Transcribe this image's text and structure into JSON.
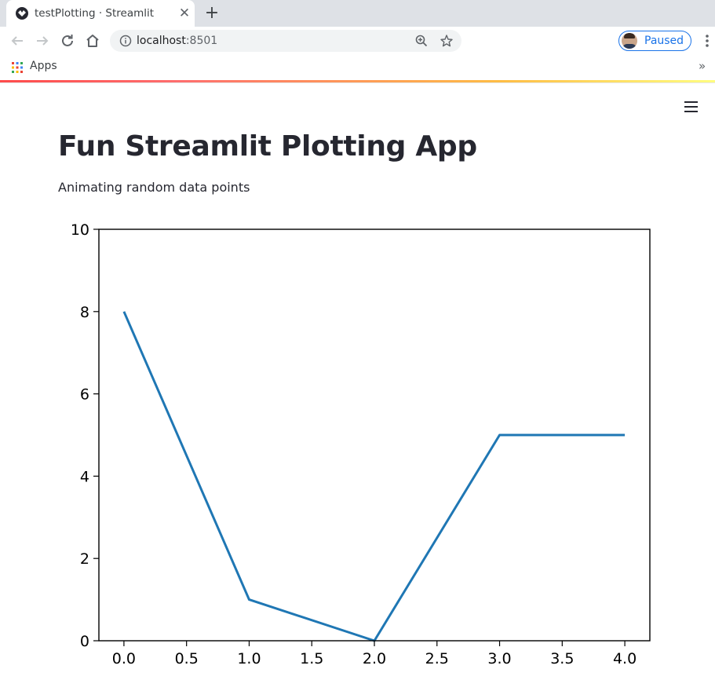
{
  "browser": {
    "tab": {
      "title": "testPlotting · Streamlit",
      "close_glyph": "✕"
    },
    "newtab_glyph": "+",
    "address": {
      "host": "localhost",
      "port": ":8501"
    },
    "profile": {
      "label": "Paused"
    },
    "bookmarks": {
      "apps_label": "Apps",
      "more_glyph": "»"
    },
    "accent_gradient": [
      "#ff4b4b",
      "#ffbd45",
      "#fffd80"
    ]
  },
  "app": {
    "menu_icon": "hamburger-menu-icon",
    "title": "Fun Streamlit Plotting App",
    "subtitle": "Animating random data points"
  },
  "chart_data": {
    "type": "line",
    "x": [
      0,
      1,
      2,
      3,
      4
    ],
    "series": [
      {
        "values": [
          8,
          1,
          0,
          5,
          5
        ],
        "color": "#1f77b4"
      }
    ],
    "xlim": [
      -0.2,
      4.2
    ],
    "ylim": [
      0,
      10
    ],
    "xticks": [
      "0.0",
      "0.5",
      "1.0",
      "1.5",
      "2.0",
      "2.5",
      "3.0",
      "3.5",
      "4.0"
    ],
    "xtick_values": [
      0,
      0.5,
      1,
      1.5,
      2,
      2.5,
      3,
      3.5,
      4
    ],
    "yticks": [
      "0",
      "2",
      "4",
      "6",
      "8",
      "10"
    ],
    "ytick_values": [
      0,
      2,
      4,
      6,
      8,
      10
    ],
    "grid": false,
    "title": "",
    "xlabel": "",
    "ylabel": ""
  }
}
